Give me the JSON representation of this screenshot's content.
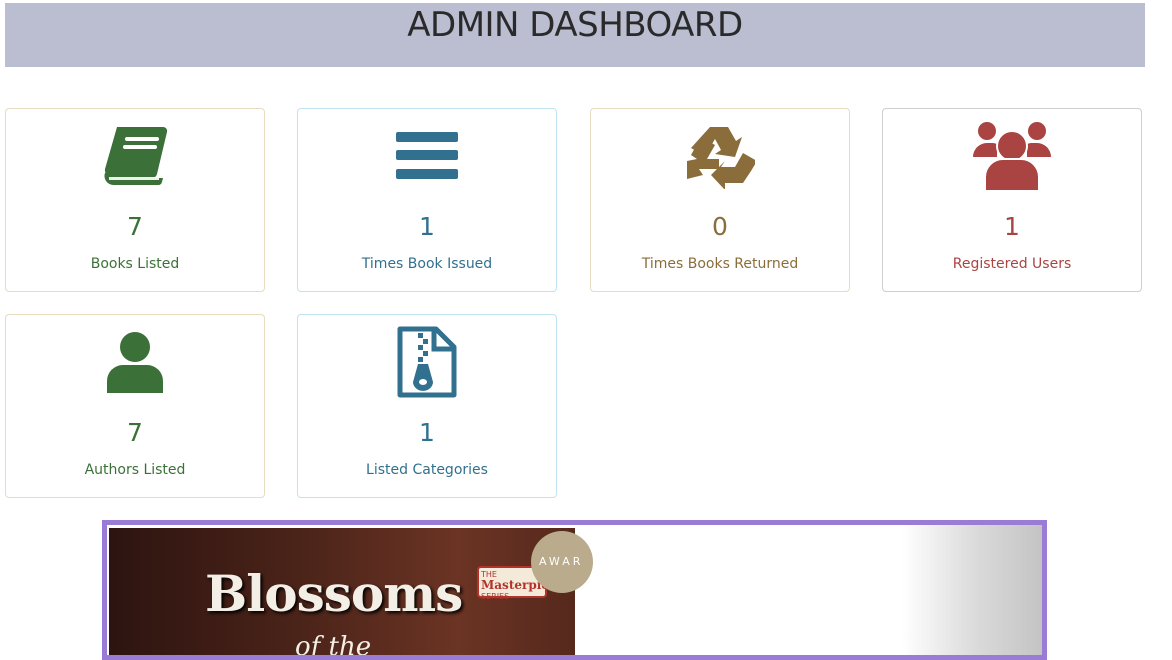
{
  "header": {
    "title": "ADMIN DASHBOARD"
  },
  "cards": [
    {
      "value": "7",
      "label": "Books Listed",
      "icon": "book-icon",
      "color": "#3b7138"
    },
    {
      "value": "1",
      "label": "Times Book Issued",
      "icon": "bars-icon",
      "color": "#31708f"
    },
    {
      "value": "0",
      "label": "Times Books Returned",
      "icon": "recycle-icon",
      "color": "#8a6d3b"
    },
    {
      "value": "1",
      "label": "Registered Users",
      "icon": "users-icon",
      "color": "#a94442"
    },
    {
      "value": "7",
      "label": "Authors Listed",
      "icon": "user-icon",
      "color": "#3b7138"
    },
    {
      "value": "1",
      "label": "Listed Categories",
      "icon": "file-zip-icon",
      "color": "#31708f"
    }
  ],
  "banner": {
    "book_title": "Blossoms",
    "book_subtitle": "of the",
    "series_top": "THE",
    "series_name": "Masterpiece",
    "series_bottom": "SERIES",
    "award_text": "AWAR",
    "border_color": "#9a7bd5"
  }
}
